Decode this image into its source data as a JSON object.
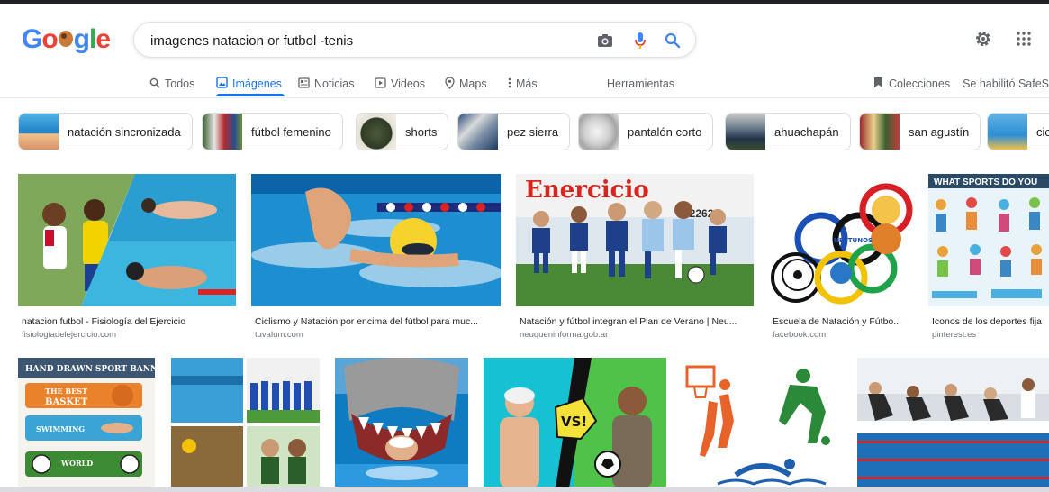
{
  "search": {
    "query": "imagenes natacion or futbol -tenis"
  },
  "tabs": [
    {
      "label": "Todos",
      "icon": "search-icon",
      "active": false
    },
    {
      "label": "Imágenes",
      "icon": "image-icon",
      "active": true
    },
    {
      "label": "Noticias",
      "icon": "news-icon",
      "active": false
    },
    {
      "label": "Videos",
      "icon": "video-icon",
      "active": false
    },
    {
      "label": "Maps",
      "icon": "map-pin-icon",
      "active": false
    },
    {
      "label": "Más",
      "icon": "more-vert-icon",
      "active": false
    }
  ],
  "tools_label": "Herramientas",
  "right_links": {
    "collections": "Colecciones",
    "safesearch": "Se habilitó SafeSe"
  },
  "chips": [
    {
      "label": "natación sincronizada"
    },
    {
      "label": "fútbol femenino"
    },
    {
      "label": "shorts"
    },
    {
      "label": "pez sierra"
    },
    {
      "label": "pantalón corto"
    },
    {
      "label": "ahuachapán"
    },
    {
      "label": "san agustín"
    },
    {
      "label": "cic"
    }
  ],
  "results_row1": [
    {
      "caption": "natacion futbol - Fisiología del Ejercicio",
      "domain": "fisiologiadelejercicio.com"
    },
    {
      "caption": "Ciclismo y Natación por encima del fútbol para muc...",
      "domain": "tuvalum.com"
    },
    {
      "caption": "Natación y fútbol integran el Plan de Verano | Neu...",
      "domain": "neuqueninforma.gob.ar"
    },
    {
      "caption": "Escuela de Natación y Fútbo...",
      "domain": "facebook.com"
    },
    {
      "caption": "Iconos de los deportes fija",
      "domain": "pinterest.es"
    }
  ],
  "image_text": {
    "banner_title": "HAND DRAWN SPORT BANNERS",
    "banner_best": "THE BEST",
    "banner_basket": "BASKET",
    "banner_swimming": "SWIMMING",
    "banner_world": "WORLD",
    "sports_title": "WHAT SPORTS DO YOU",
    "vs": "VS!",
    "ring_text": "NEPTUNOS",
    "mural": "Enercicio",
    "mural_num": "12262"
  },
  "colors": {
    "accent_blue": "#1a73e8",
    "logo_blue": "#4285f4",
    "logo_red": "#ea4335",
    "logo_yellow": "#fbbc05",
    "logo_green": "#34a853"
  }
}
